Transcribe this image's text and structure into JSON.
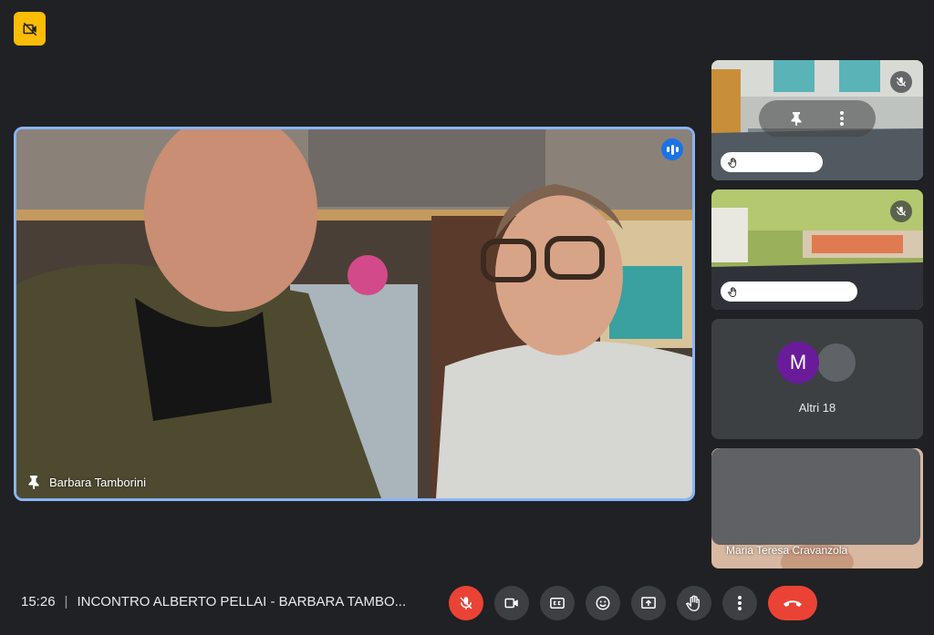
{
  "meeting": {
    "time": "15:26",
    "separator": "|",
    "title": "INCONTRO ALBERTO PELLAI - BARBARA TAMBO..."
  },
  "main_tile": {
    "participant_name": "Barbara Tamborini",
    "pin_icon": "pin-icon",
    "speaking_icon": "speaking-indicator-icon"
  },
  "side_tiles": [
    {
      "name": "",
      "muted": true,
      "has_hand_raised_pill": true,
      "show_pin_overlay": true
    },
    {
      "name": "",
      "muted": true,
      "has_hand_raised_pill": true
    },
    {
      "others_initial": "M",
      "others_label": "Altri 18"
    },
    {
      "name": "Maria Teresa Cravanzola"
    }
  ],
  "controls": [
    {
      "name": "microphone",
      "icon": "mic-off-icon",
      "state": "off"
    },
    {
      "name": "camera",
      "icon": "video-icon"
    },
    {
      "name": "captions",
      "icon": "closed-captions-icon"
    },
    {
      "name": "reactions",
      "icon": "emoji-icon"
    },
    {
      "name": "present",
      "icon": "present-screen-icon"
    },
    {
      "name": "raise-hand",
      "icon": "hand-icon"
    },
    {
      "name": "more-options",
      "icon": "more-vert-icon"
    },
    {
      "name": "leave-call",
      "icon": "call-end-icon"
    }
  ],
  "colors": {
    "background": "#202124",
    "active_speaker_border": "#8ab4f8",
    "danger": "#ea4335",
    "badge": "#fbbc04",
    "avatar_m": "#6a1b9a"
  }
}
